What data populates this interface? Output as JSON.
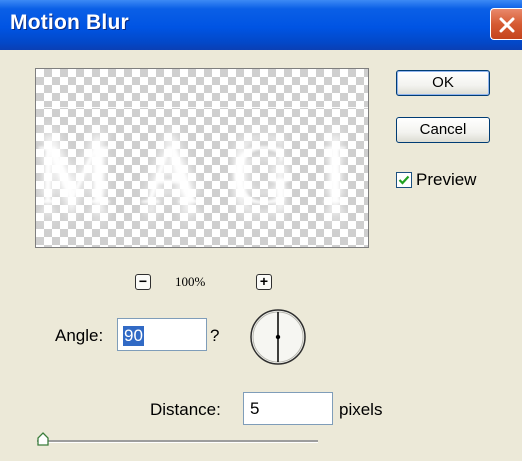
{
  "window": {
    "title": "Motion Blur",
    "close_icon": "close-icon"
  },
  "preview": {
    "sample_text": "MAGIC"
  },
  "zoom": {
    "minus_label": "−",
    "plus_label": "+",
    "level": "100%"
  },
  "buttons": {
    "ok_label": "OK",
    "cancel_label": "Cancel"
  },
  "preview_toggle": {
    "label": "Preview",
    "checked": true
  },
  "angle": {
    "label": "Angle:",
    "value": "90",
    "unit": "?"
  },
  "distance": {
    "label": "Distance:",
    "value": "5",
    "unit": "pixels"
  },
  "colors": {
    "titlebar": "#0054e3",
    "dialog_bg": "#ece9d8",
    "selection": "#316ac5",
    "close": "#d65b33"
  }
}
